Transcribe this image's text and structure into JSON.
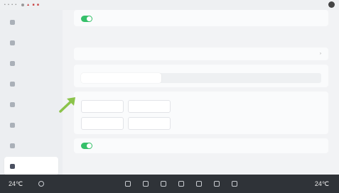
{
  "statusbar": {
    "left_text": "• • • •",
    "mid_text": "▲ ■ ■",
    "icon_names": [
      "signal-icon",
      "wifi-icon",
      "battery-icon",
      "account-icon"
    ]
  },
  "sidebar": {
    "items": [
      {
        "label": "",
        "icon": "user-icon"
      },
      {
        "label": "",
        "icon": "display-icon"
      },
      {
        "label": "",
        "icon": "sound-icon"
      },
      {
        "label": "",
        "icon": "bluetooth-icon"
      },
      {
        "label": "",
        "icon": "wifi-icon"
      },
      {
        "label": "",
        "icon": "vehicle-icon"
      },
      {
        "label": "",
        "icon": "drive-icon"
      },
      {
        "label": "",
        "icon": "voice-icon",
        "active": true
      },
      {
        "label": "",
        "icon": "info-icon"
      }
    ]
  },
  "content": {
    "top_toggle": {
      "title": "",
      "sub": ""
    },
    "lang_select": {
      "title": "",
      "value": ""
    },
    "segmented": {
      "title": "",
      "sub": "",
      "options": [
        "",
        "",
        ""
      ],
      "selected_index": 0
    },
    "voice_style": {
      "title": "",
      "sub": "",
      "options": [
        {
          "t": "",
          "s": ""
        },
        {
          "t": "",
          "s": ""
        },
        {
          "t": "",
          "s": ""
        },
        {
          "t": "",
          "s": ""
        }
      ]
    },
    "bottom_toggle": {
      "title": ""
    }
  },
  "dock": {
    "left_temp": "24℃",
    "right_temp": "24℃",
    "info": ""
  },
  "colors": {
    "accent_green": "#36c06a",
    "arrow_green": "#8bc34a",
    "dock_bg": "#2f3338"
  }
}
